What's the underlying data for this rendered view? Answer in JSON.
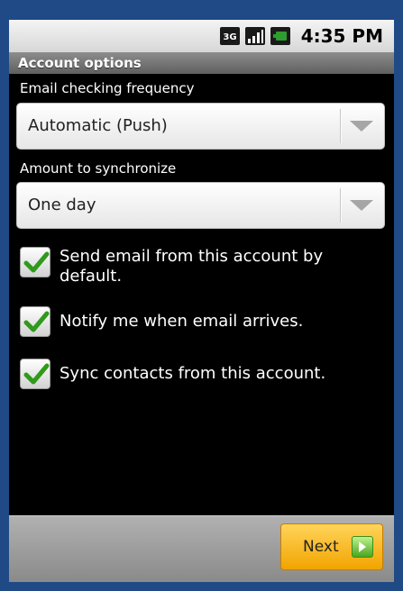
{
  "status_bar": {
    "time": "4:35 PM",
    "network_badge": "3G",
    "icons": [
      "3g-icon",
      "signal-bars-icon",
      "battery-icon"
    ]
  },
  "title": "Account options",
  "email_checking": {
    "label": "Email checking frequency",
    "selected": "Automatic (Push)"
  },
  "sync_amount": {
    "label": "Amount to synchronize",
    "selected": "One day"
  },
  "checkboxes": [
    {
      "label": "Send email from this account by default.",
      "checked": true
    },
    {
      "label": "Notify me when email arrives.",
      "checked": true
    },
    {
      "label": "Sync contacts from this account.",
      "checked": true
    }
  ],
  "next_button": {
    "label": "Next"
  },
  "colors": {
    "frame": "#1f4a86",
    "background": "#000000",
    "accent_button": "#f2a400",
    "check_green": "#2f9a1b"
  }
}
